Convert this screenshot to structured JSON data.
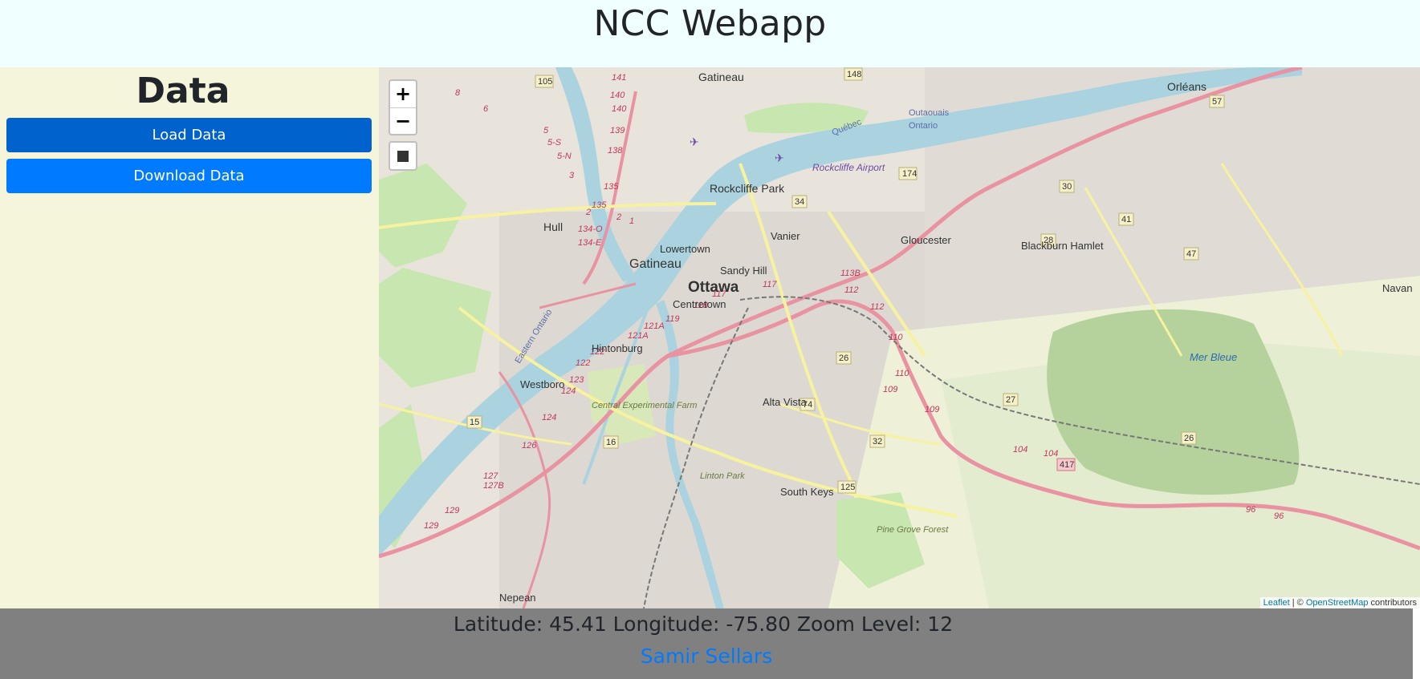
{
  "header": {
    "title": "NCC Webapp"
  },
  "sidebar": {
    "title": "Data",
    "load_button": "Load Data",
    "download_button": "Download Data"
  },
  "map": {
    "zoom_in": "+",
    "zoom_out": "−",
    "attribution": {
      "leaflet": "Leaflet",
      "separator": " | © ",
      "osm": "OpenStreetMap",
      "contributors": " contributors"
    },
    "places": {
      "gatineau_n": "Gatineau",
      "orleans": "Orléans",
      "rockcliffe_park": "Rockcliffe Park",
      "rockcliffe_airport": "Rockcliffe Airport",
      "hull": "Hull",
      "lowertown": "Lowertown",
      "vanier": "Vanier",
      "gloucester": "Gloucester",
      "blackburn": "Blackburn Hamlet",
      "gatineau": "Gatineau",
      "sandy_hill": "Sandy Hill",
      "ottawa": "Ottawa",
      "centretown": "Centretown",
      "hintonburg": "Hintonburg",
      "westboro": "Westboro",
      "mer_bleue": "Mer Bleue",
      "central_farm": "Central Experimental Farm",
      "alta_vista": "Alta Vista",
      "linton_park": "Linton Park",
      "south_keys": "South Keys",
      "pine_grove": "Pine Grove Forest",
      "nepean": "Nepean",
      "navan": "Navan",
      "quebec": "Québec",
      "outaouais": "Outaouais",
      "ontario": "Ontario",
      "eastern_ontario": "Eastern Ontario"
    }
  },
  "footer": {
    "coords": "Latitude: 45.41 Longitude: -75.80 Zoom Level: 12",
    "author": "Samir Sellars"
  },
  "colors": {
    "header_bg": "#f0ffff",
    "sidebar_bg": "#f5f5dc",
    "footer_bg": "#808080",
    "btn_primary": "#007bff",
    "btn_active": "#0062cc",
    "water": "#aad3df",
    "park": "#c8e6b0",
    "highway": "#e892a2"
  }
}
